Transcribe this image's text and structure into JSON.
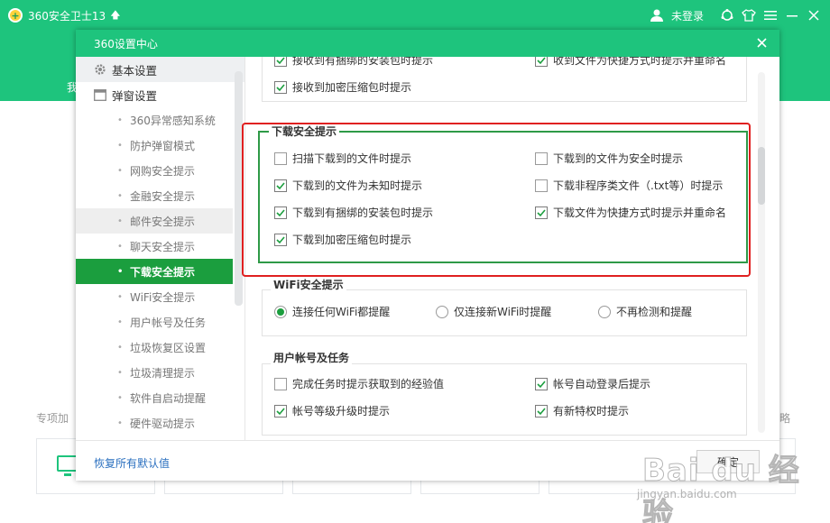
{
  "app": {
    "title": "360安全卫士13",
    "login_label": "未登录",
    "edge_text_left": "我",
    "edge_label_left": "专项加",
    "edge_label_right": "略",
    "colors": {
      "brand": "#1ec47d"
    }
  },
  "dialog": {
    "title": "360设置中心",
    "sidebar": {
      "groups": [
        {
          "label": "基本设置",
          "icon": "gear-icon"
        },
        {
          "label": "弹窗设置",
          "icon": "window-icon"
        }
      ],
      "items": [
        "360异常感知系统",
        "防护弹窗模式",
        "网购安全提示",
        "金融安全提示",
        "邮件安全提示",
        "聊天安全提示",
        "下载安全提示",
        "WiFi安全提示",
        "用户帐号及任务",
        "垃圾恢复区设置",
        "垃圾清理提示",
        "软件自启动提醒",
        "硬件驱动提示"
      ],
      "active_item": "下载安全提示"
    },
    "content": {
      "top_partial": {
        "left_cut": "接收到有捆绑的安装包时提示",
        "right_cut": "收到文件为快捷方式时提示并重命名",
        "archive": "接收到加密压缩包时提示"
      },
      "download": {
        "title": "下载安全提示",
        "options": [
          {
            "label": "扫描下载到的文件时提示",
            "checked": false
          },
          {
            "label": "下载到的文件为安全时提示",
            "checked": false
          },
          {
            "label": "下载到的文件为未知时提示",
            "checked": true
          },
          {
            "label": "下载非程序类文件（.txt等）时提示",
            "checked": false
          },
          {
            "label": "下载到有捆绑的安装包时提示",
            "checked": true
          },
          {
            "label": "下载文件为快捷方式时提示并重命名",
            "checked": true
          },
          {
            "label": "下载到加密压缩包时提示",
            "checked": true
          }
        ]
      },
      "wifi": {
        "title": "WiFi安全提示",
        "options": [
          {
            "label": "连接任何WiFi都提醒",
            "selected": true
          },
          {
            "label": "仅连接新WiFi时提醒",
            "selected": false
          },
          {
            "label": "不再检测和提醒",
            "selected": false
          }
        ]
      },
      "account": {
        "title": "用户帐号及任务",
        "options": [
          {
            "label": "完成任务时提示获取到的经验值",
            "checked": false
          },
          {
            "label": "帐号自动登录后提示",
            "checked": true
          },
          {
            "label": "帐号等级升级时提示",
            "checked": true
          },
          {
            "label": "有新特权时提示",
            "checked": true
          }
        ]
      }
    },
    "footer": {
      "restore_label": "恢复所有默认值",
      "ok_label": "确定"
    }
  },
  "watermark": {
    "text": "Bai du 经验",
    "url": "jingyan.baidu.com"
  },
  "colors": {
    "accent": "#1b9e3e",
    "highlight_frame": "#e02020",
    "link": "#2a6fbf"
  }
}
